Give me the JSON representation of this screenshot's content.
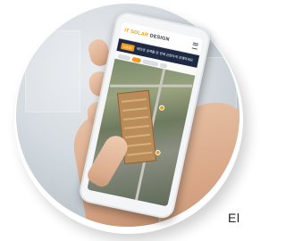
{
  "app": {
    "logo_prefix": "IT SOLAR",
    "logo_suffix": "DESIGN",
    "banner_tag": "드론3D",
    "banner_text": "태양광 설계를 한 번에 간편하게 진행하세요"
  },
  "caption_fragment": "El",
  "colors": {
    "accent": "#f29a1e",
    "banner_bg": "#1e2a44"
  }
}
